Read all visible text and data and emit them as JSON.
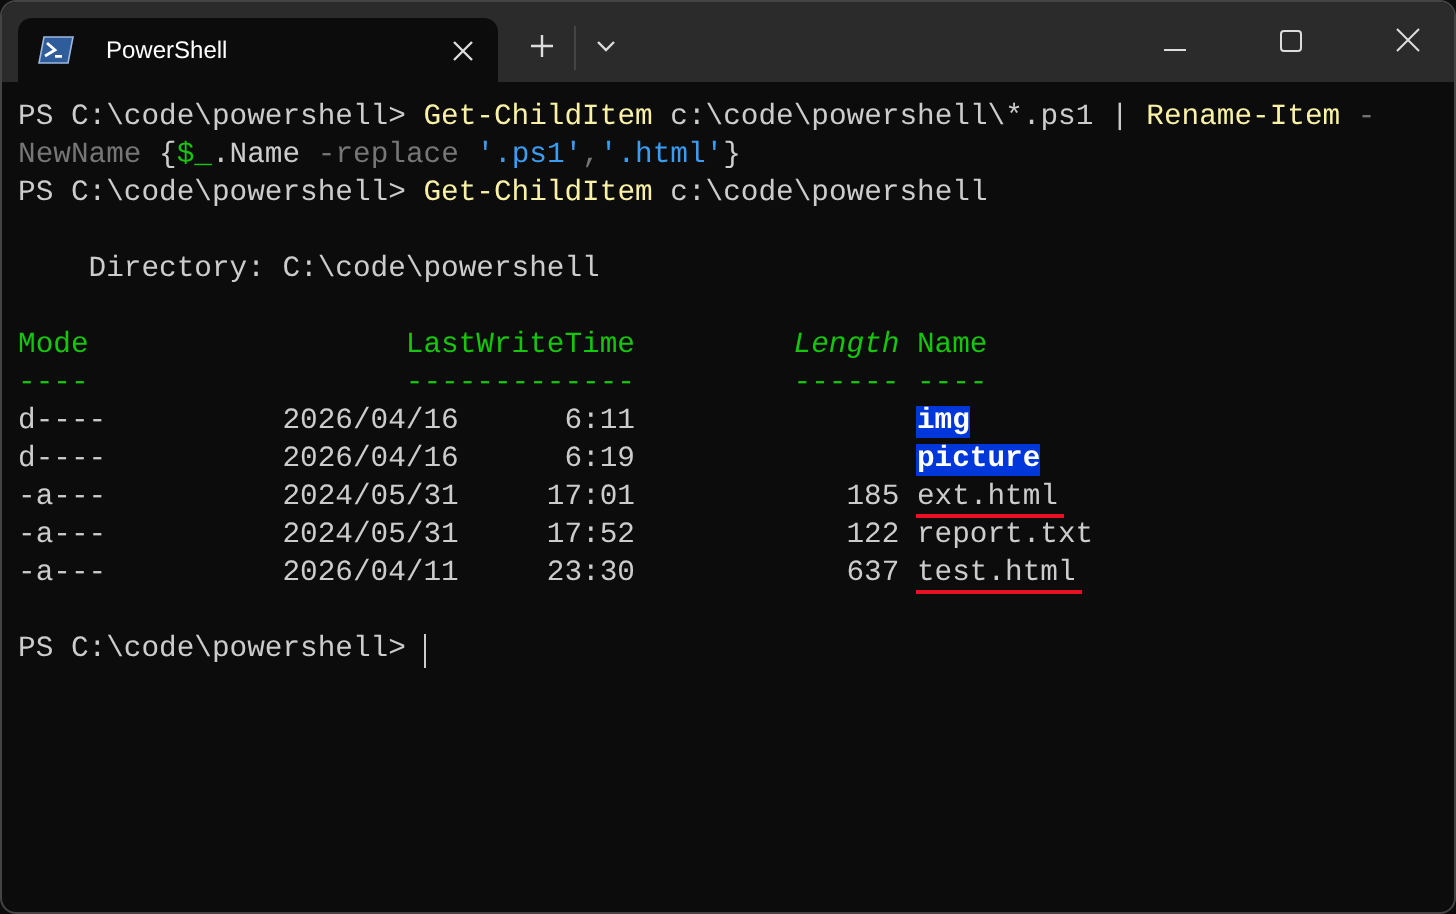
{
  "tab": {
    "title": "PowerShell",
    "selected": true
  },
  "command_lines": [
    [
      {
        "kind": "prompt",
        "text": "PS C:\\code\\powershell> "
      },
      {
        "kind": "command",
        "text": "Get-ChildItem"
      },
      {
        "kind": "plain",
        "text": " c:\\code\\powershell\\*.ps1 | "
      },
      {
        "kind": "command",
        "text": "Rename-Item"
      },
      {
        "kind": "param",
        "text": " -"
      }
    ],
    [
      {
        "kind": "param",
        "text": "NewName"
      },
      {
        "kind": "plain",
        "text": " {"
      },
      {
        "kind": "variable",
        "text": "$_"
      },
      {
        "kind": "plain",
        "text": ".Name "
      },
      {
        "kind": "param",
        "text": "-replace "
      },
      {
        "kind": "string",
        "text": "'.ps1'"
      },
      {
        "kind": "param",
        "text": ","
      },
      {
        "kind": "string",
        "text": "'.html'"
      },
      {
        "kind": "plain",
        "text": "}"
      }
    ],
    [
      {
        "kind": "prompt",
        "text": "PS C:\\code\\powershell> "
      },
      {
        "kind": "command",
        "text": "Get-ChildItem"
      },
      {
        "kind": "plain",
        "text": " c:\\code\\powershell"
      }
    ]
  ],
  "directory": "    Directory: C:\\code\\powershell",
  "columns": [
    {
      "label": "Mode",
      "rule": "----",
      "italic": false
    },
    {
      "label": "LastWriteTime",
      "rule": "-------------",
      "italic": false
    },
    {
      "label": "Length",
      "rule": "------",
      "italic": true
    },
    {
      "label": "Name",
      "rule": "----",
      "italic": false
    }
  ],
  "rows": [
    {
      "mode": "d----",
      "date": "2026/04/16",
      "time": "6:11",
      "name": "img",
      "highlighted": true,
      "underlined": false
    },
    {
      "mode": "d----",
      "date": "2026/04/16",
      "time": "6:19",
      "name": "picture",
      "highlighted": true,
      "underlined": false
    },
    {
      "mode": "-a---",
      "date": "2024/05/31",
      "time": "17:01",
      "length": "185",
      "name": "ext.html",
      "highlighted": false,
      "underlined": true
    },
    {
      "mode": "-a---",
      "date": "2024/05/31",
      "time": "17:52",
      "length": "122",
      "name": "report.txt",
      "highlighted": false,
      "underlined": false
    },
    {
      "mode": "-a---",
      "date": "2026/04/11",
      "time": "23:30",
      "length": "637",
      "name": "test.html",
      "highlighted": false,
      "underlined": true
    }
  ],
  "final_prompt": "PS C:\\code\\powershell> "
}
